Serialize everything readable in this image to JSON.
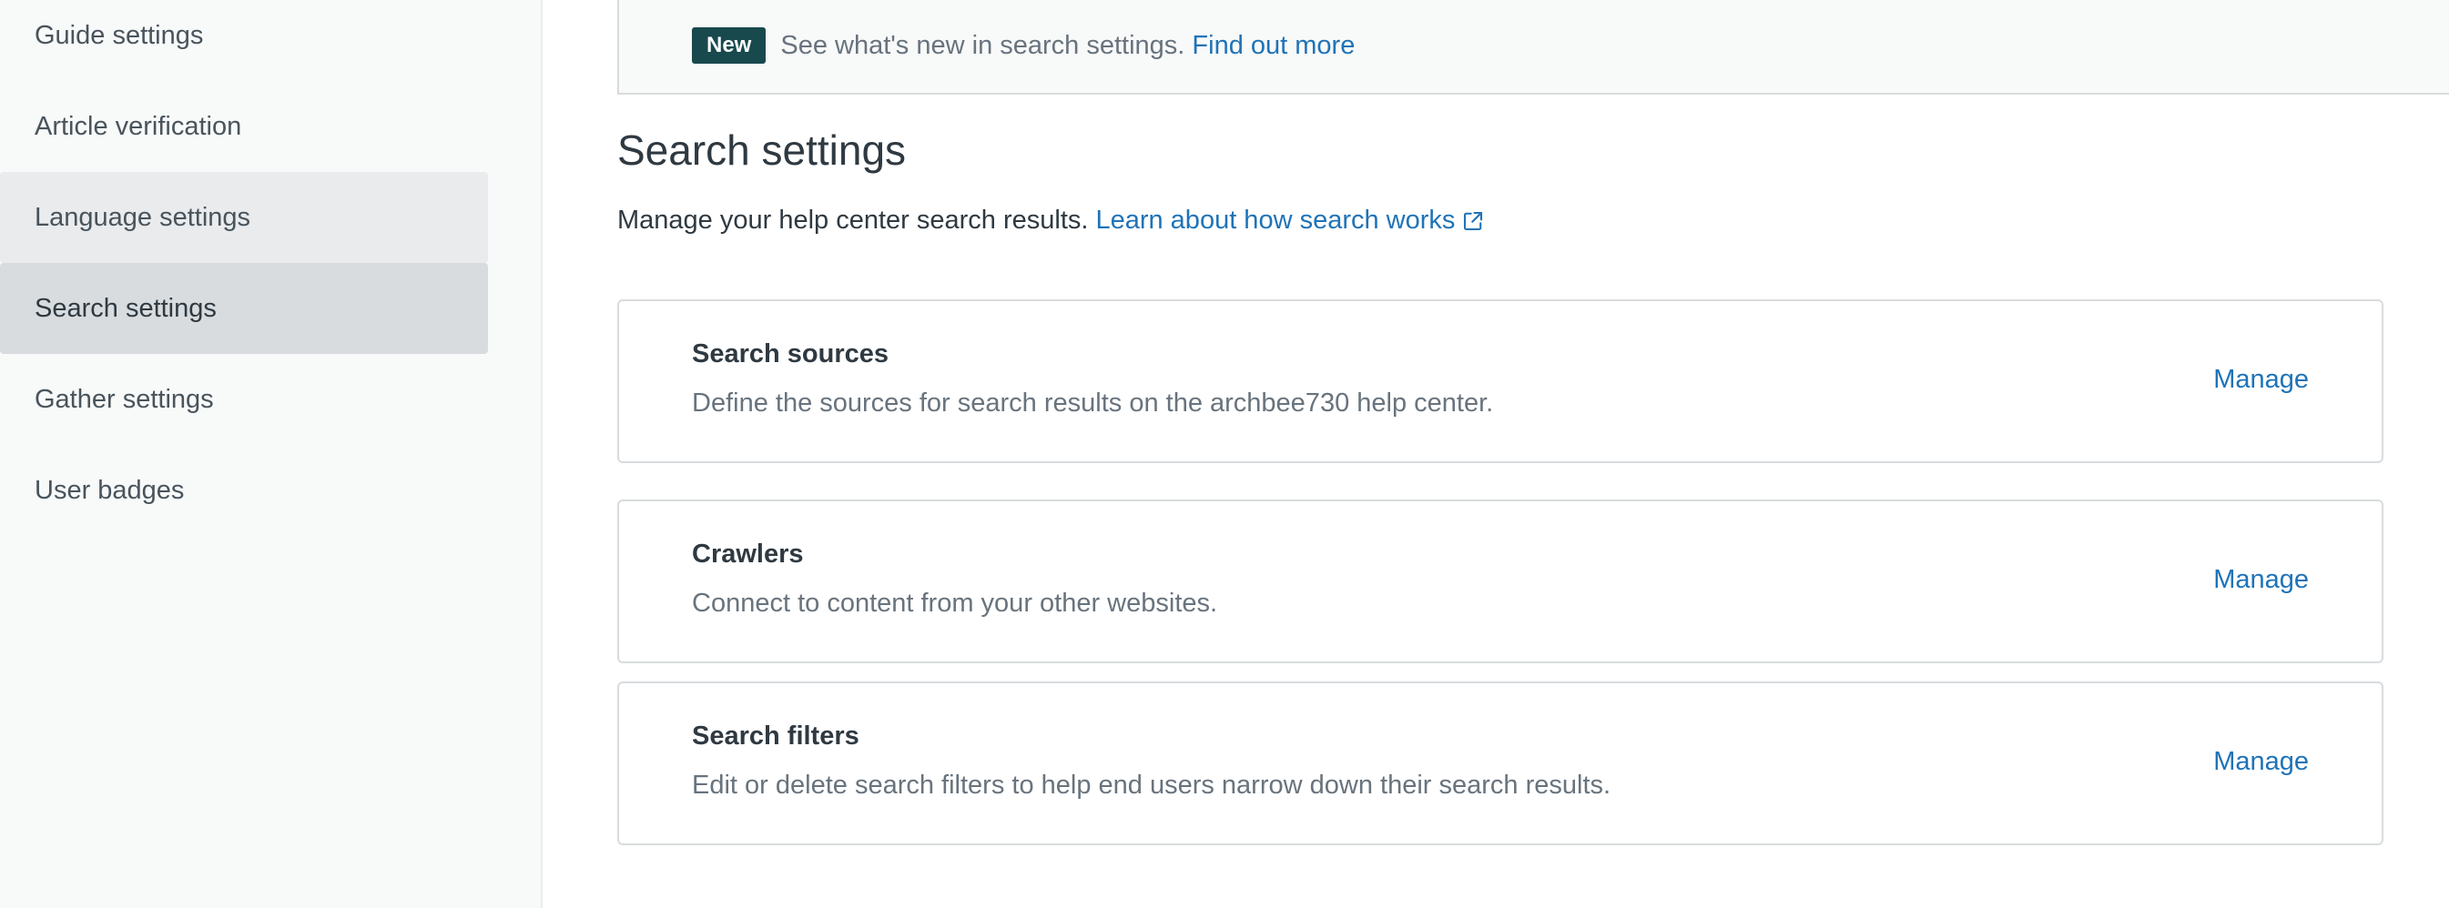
{
  "sidebar": {
    "items": [
      {
        "label": "Guide settings"
      },
      {
        "label": "Article verification"
      },
      {
        "label": "Language settings"
      },
      {
        "label": "Search settings"
      },
      {
        "label": "Gather settings"
      },
      {
        "label": "User badges"
      }
    ],
    "active_item": "Search settings"
  },
  "banner": {
    "badge": "New",
    "text": "See what's new in search settings.",
    "link": "Find out more"
  },
  "main": {
    "title": "Search settings",
    "subtitle": "Manage your help center search results.",
    "subtitle_link": "Learn about how search works",
    "cards": [
      {
        "title": "Search sources",
        "description": "Define the sources for search results on the archbee730 help center.",
        "action": "Manage"
      },
      {
        "title": "Crawlers",
        "description": "Connect to content from your other websites.",
        "action": "Manage"
      },
      {
        "title": "Search filters",
        "description": "Edit or delete search filters to help end users narrow down their search results.",
        "action": "Manage"
      }
    ]
  },
  "colors": {
    "link": "#1f73b7",
    "badge_bg": "#17494d",
    "active_item_bg": "#d8dcde",
    "sidebar_bg": "#f8f9f9"
  },
  "icons": {
    "external_link": "external-link-icon"
  }
}
